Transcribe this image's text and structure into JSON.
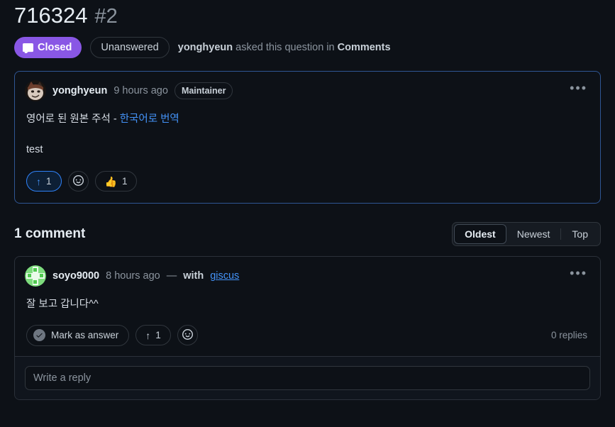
{
  "header": {
    "title": "716324",
    "number": "#2",
    "status_badge": {
      "label": "Closed",
      "icon": "discussion-closed-icon",
      "color": "#8957e5"
    },
    "answered_badge": {
      "label": "Unanswered"
    },
    "meta_author": "yonghyeun",
    "meta_middle": " asked this question in ",
    "meta_category": "Comments"
  },
  "original_post": {
    "avatar_icon": "user-avatar-cat",
    "author": "yonghyeun",
    "timestamp": "9 hours ago",
    "role_badge": "Maintainer",
    "menu_icon": "kebab-menu-icon",
    "body_text_plain": "영어로 된 원본 주석 - ",
    "body_text_link": "한국어로 번역",
    "body_line_2": "test",
    "reactions": {
      "upvote": {
        "icon": "up-arrow-icon",
        "count": "1",
        "active": true
      },
      "add_reaction": {
        "icon": "smiley-icon"
      },
      "thumbs_up": {
        "icon": "thumbs-up-icon",
        "emoji": "👍",
        "count": "1"
      }
    }
  },
  "comments_section": {
    "heading": "1 comment",
    "sort_options": [
      {
        "label": "Oldest",
        "active": true
      },
      {
        "label": "Newest",
        "active": false
      },
      {
        "label": "Top",
        "active": false
      }
    ]
  },
  "comment": {
    "avatar_icon": "user-avatar-identicon",
    "author": "soyo9000",
    "timestamp": "8 hours ago",
    "dash": "—",
    "with_label": "with",
    "with_link": "giscus",
    "menu_icon": "kebab-menu-icon",
    "body": "잘 보고 갑니다^^",
    "actions": {
      "mark_as_answer": {
        "label": "Mark as answer",
        "icon": "check-circle-icon"
      },
      "upvote": {
        "icon": "up-arrow-icon",
        "count": "1"
      },
      "add_reaction": {
        "icon": "smiley-icon"
      },
      "replies": "0 replies"
    },
    "reply_placeholder": "Write a reply"
  },
  "colors": {
    "background": "#0d1117",
    "accent_purple": "#8957e5",
    "link_blue": "#4493f8",
    "highlight_border": "#2f5694"
  }
}
